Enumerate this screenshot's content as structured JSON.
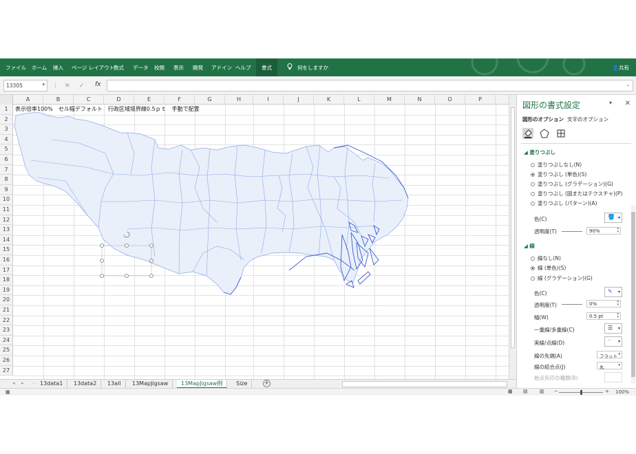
{
  "ribbon": {
    "tabs": [
      "ファイル",
      "ホーム",
      "挿入",
      "ページ レイアウト",
      "数式",
      "データ",
      "校閲",
      "表示",
      "開発",
      "アドイン",
      "ヘルプ"
    ],
    "active_tab": "書式",
    "tell_me": "何をしますか",
    "share": "共有"
  },
  "formula_bar": {
    "name_box": "13305",
    "fx": "fx",
    "formula": ""
  },
  "grid": {
    "columns": [
      "A",
      "B",
      "C",
      "D",
      "E",
      "F",
      "G",
      "H",
      "I",
      "J",
      "K",
      "L",
      "M",
      "N",
      "O",
      "P"
    ],
    "rows": [
      "1",
      "2",
      "3",
      "4",
      "5",
      "6",
      "7",
      "8",
      "9",
      "10",
      "11",
      "12",
      "13",
      "14",
      "15",
      "16",
      "17",
      "18",
      "19",
      "20",
      "21",
      "22",
      "23",
      "24",
      "25",
      "26",
      "27"
    ],
    "a1_text": "表示倍率100%　セル幅デフォルト　行政区域境界線0.5ｐｔ　手動で配置"
  },
  "sheets": {
    "tabs": [
      "13data1",
      "13data2",
      "13all",
      "13MapJigsaw",
      "13MapJigsaw例",
      "Size"
    ],
    "active": "13MapJigsaw例"
  },
  "status": {
    "zoom": "100%"
  },
  "pane": {
    "title": "図形の書式設定",
    "tab_shape": "図形のオプション",
    "tab_text": "文字のオプション",
    "fill": {
      "header": "塗りつぶし",
      "options": [
        "塗りつぶしなし(N)",
        "塗りつぶし (単色)(S)",
        "塗りつぶし (グラデーション)(G)",
        "塗りつぶし (図またはテクスチャ)(P)",
        "塗りつぶし (パターン)(A)"
      ],
      "selected_index": 1,
      "color_label": "色(C)",
      "transparency_label": "透明度(T)",
      "transparency_value": "90%"
    },
    "line": {
      "header": "線",
      "options": [
        "線なし(N)",
        "線 (単色)(S)",
        "線 (グラデーション)(G)"
      ],
      "selected_index": 1,
      "color_label": "色(C)",
      "transparency_label": "透明度(T)",
      "transparency_value": "0%",
      "width_label": "幅(W)",
      "width_value": "0.5 pt",
      "compound_label": "一重線/多重線(C)",
      "dash_label": "実線/点線(D)",
      "cap_label": "線の先端(A)",
      "cap_value": "フラット",
      "join_label": "線の結合点(J)",
      "join_value": "丸",
      "arrow_label": "始点矢印の種類(B)"
    }
  },
  "colors": {
    "excel_green": "#217346",
    "map_fill": "#e9f0fa",
    "map_stroke": "#3b5bd6"
  }
}
